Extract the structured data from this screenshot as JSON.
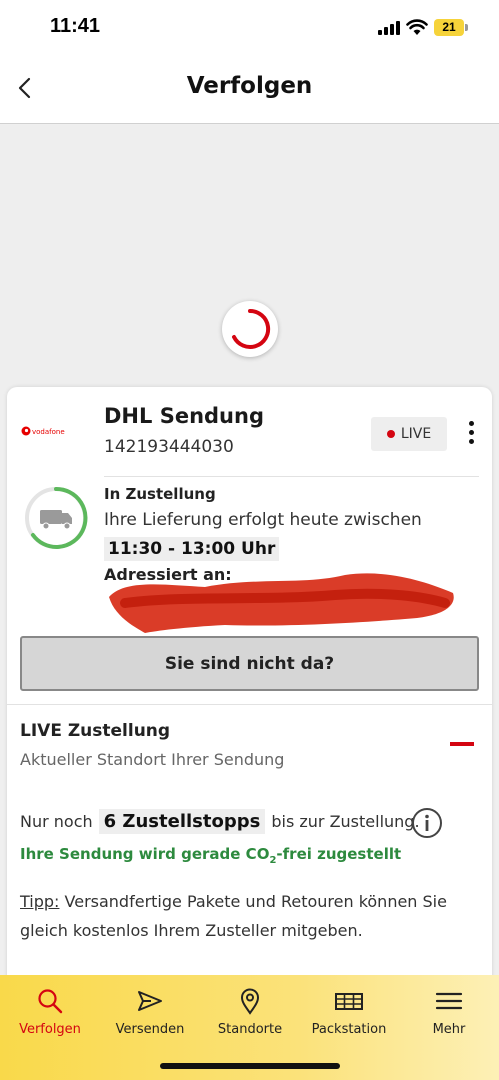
{
  "status_bar": {
    "time": "11:41",
    "battery": "21"
  },
  "header": {
    "title": "Verfolgen"
  },
  "shipment": {
    "carrier_logo_text": "vodafone",
    "title": "DHL Sendung",
    "tracking_number": "142193444030",
    "live_badge": "LIVE",
    "status_label": "In Zustellung",
    "status_text": "Ihre Lieferung erfolgt heute zwischen",
    "time_window": "11:30 - 13:00 Uhr",
    "address_label": "Adressiert an:",
    "not_home_button": "Sie sind nicht da?"
  },
  "live_delivery": {
    "title": "LIVE Zustellung",
    "subtitle": "Aktueller Standort Ihrer Sendung",
    "stops_prefix": "Nur noch",
    "stops_count": "6 Zustellstopps",
    "stops_suffix": "bis zur Zustellung.",
    "co2_prefix": "Ihre Sendung wird gerade CO",
    "co2_sub": "2",
    "co2_suffix": "-frei zugestellt",
    "tip_label": "Tipp:",
    "tip_text": " Versandfertige Pakete und Retouren können Sie gleich kostenlos Ihrem Zusteller mitgeben."
  },
  "tabs": [
    {
      "label": "Verfolgen",
      "icon": "search-icon",
      "active": true
    },
    {
      "label": "Versenden",
      "icon": "send-icon",
      "active": false
    },
    {
      "label": "Standorte",
      "icon": "location-pin-icon",
      "active": false
    },
    {
      "label": "Packstation",
      "icon": "packstation-icon",
      "active": false
    },
    {
      "label": "Mehr",
      "icon": "menu-icon",
      "active": false
    }
  ],
  "colors": {
    "dhl_red": "#d40511",
    "dhl_yellow": "#f9d94a",
    "co2_green": "#2d8a3e",
    "status_ring_green": "#5cb85c"
  }
}
